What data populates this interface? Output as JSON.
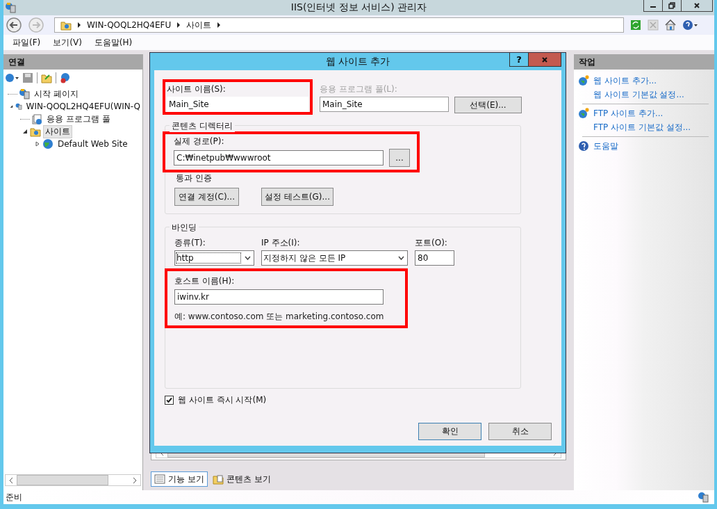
{
  "window": {
    "title": "IIS(인터넷 정보 서비스) 관리자"
  },
  "address_bar": {
    "crumbs": [
      "WIN-QOQL2HQ4EFU",
      "사이트"
    ]
  },
  "menu": [
    "파일(F)",
    "보기(V)",
    "도움말(H)"
  ],
  "connections": {
    "title": "연결",
    "tree": [
      {
        "label": "시작 페이지",
        "kind": "start",
        "selected": false
      },
      {
        "label": "WIN-QOQL2HQ4EFU(WIN-Q",
        "kind": "server",
        "expanded": true,
        "selected": false,
        "children": [
          {
            "label": "응용 프로그램 풀",
            "kind": "pool",
            "selected": false
          },
          {
            "label": "사이트",
            "kind": "folder",
            "expanded": true,
            "selected": true,
            "children": [
              {
                "label": "Default Web Site",
                "kind": "globe",
                "expanded": false,
                "selected": false
              }
            ]
          }
        ]
      }
    ]
  },
  "view_tabs": [
    {
      "label": "기능 보기",
      "kind": "features",
      "selected": true
    },
    {
      "label": "콘텐츠 보기",
      "kind": "content",
      "selected": false
    }
  ],
  "actions": {
    "title": "작업",
    "groups": [
      [
        {
          "label": "웹 사이트 추가...",
          "kind": "add"
        },
        {
          "label": "웹 사이트 기본값 설정...",
          "kind": "plain"
        }
      ],
      [
        {
          "label": "FTP 사이트 추가...",
          "kind": "add"
        },
        {
          "label": "FTP 사이트 기본값 설정...",
          "kind": "plain"
        }
      ],
      [
        {
          "label": "도움말",
          "kind": "help"
        }
      ]
    ]
  },
  "dialog": {
    "title": "웹 사이트 추가",
    "help_button": "?",
    "site_name": {
      "label": "사이트 이름(S):",
      "value": "Main_Site",
      "highlighted": true
    },
    "app_pool": {
      "label": "응용 프로그램 풀(L):",
      "value": "Main_Site",
      "disabled": true
    },
    "select_button": "선택(E)...",
    "content_directory": {
      "title": "콘텐츠 디렉터리",
      "path_label": "실제 경로(P):",
      "path_value": "C:₩inetpub₩wwwroot",
      "browse_button": "...",
      "highlighted": true,
      "auth_label": "통과 인증",
      "connect_as_button": "연결 계정(C)...",
      "test_button": "설정 테스트(G)..."
    },
    "binding": {
      "title": "바인딩",
      "type_label": "종류(T):",
      "type_value": "http",
      "ip_label": "IP 주소(I):",
      "ip_value": "지정하지 않은 모든 IP",
      "port_label": "포트(O):",
      "port_value": "80",
      "host_label": "호스트 이름(H):",
      "host_value": "iwinv.kr",
      "host_highlighted": true,
      "example": "예: www.contoso.com 또는 marketing.contoso.com"
    },
    "start_immediately": {
      "label": "웹 사이트 즉시 시작(M)",
      "checked": true
    },
    "buttons": [
      "확인",
      "취소"
    ]
  },
  "status_bar": "준비"
}
